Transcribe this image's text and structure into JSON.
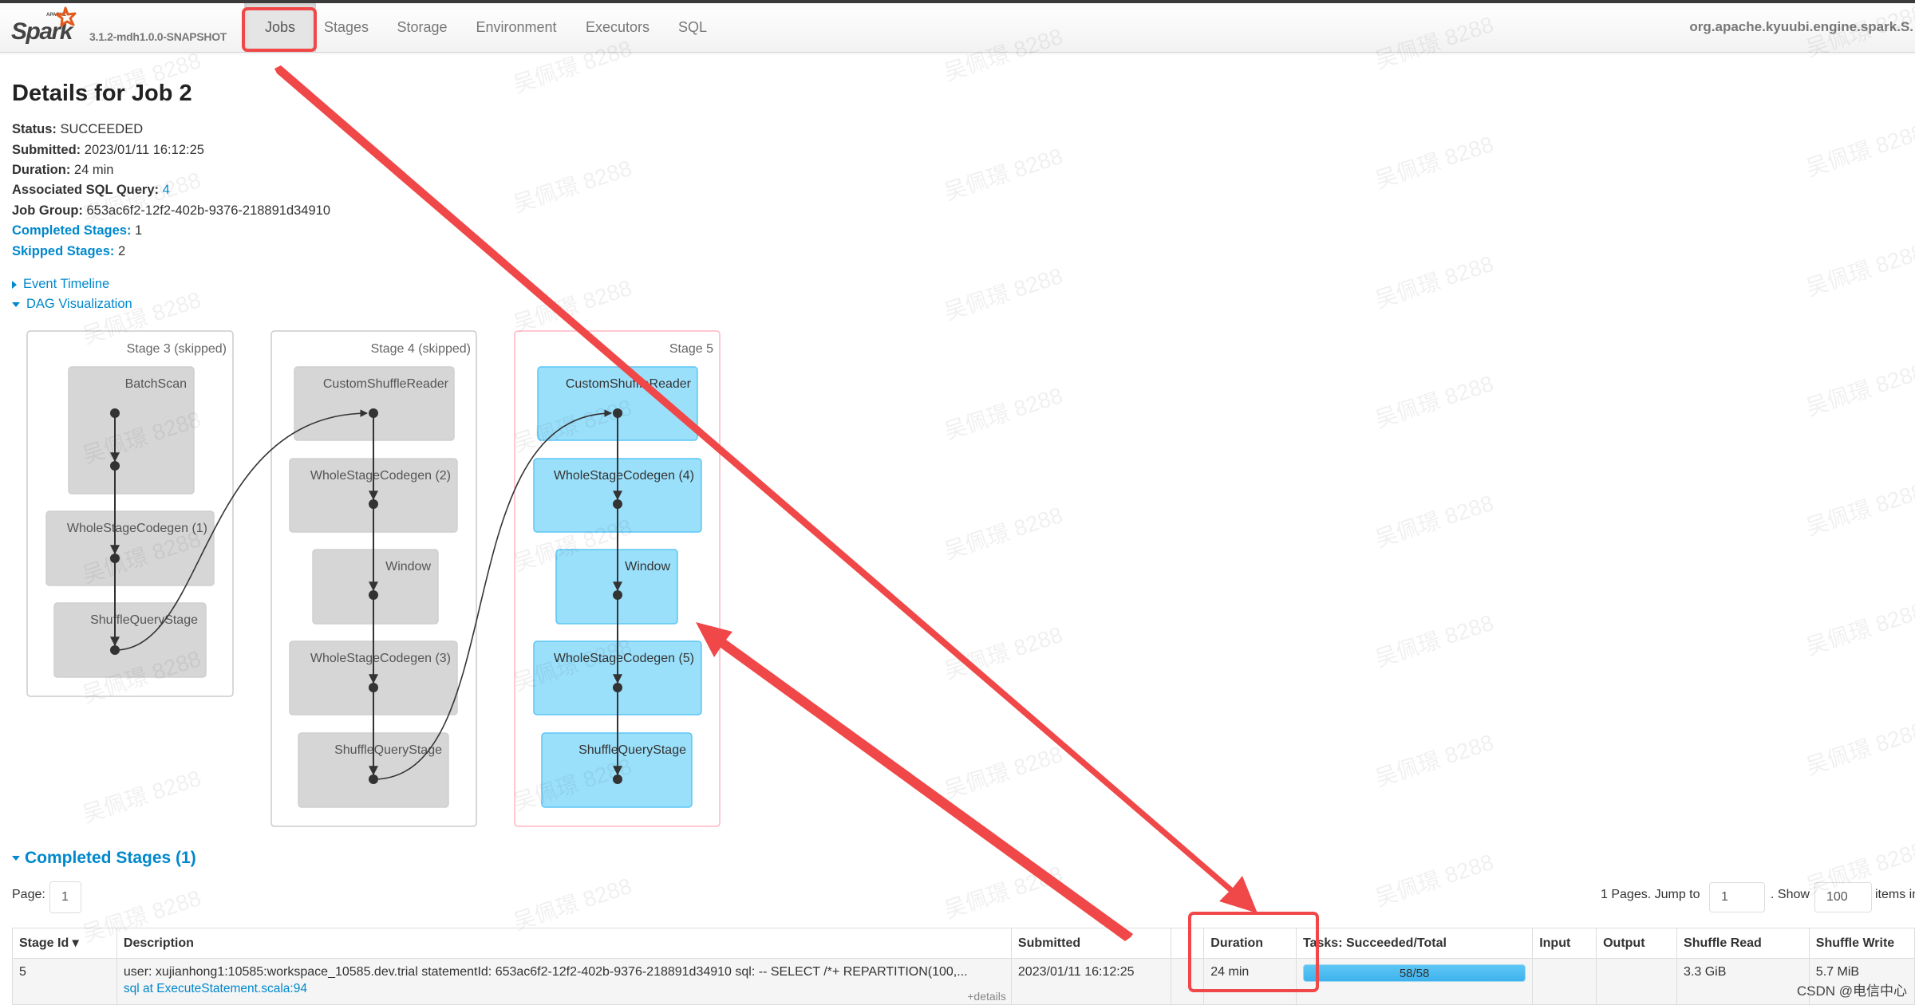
{
  "navbar": {
    "logo_text": "Spark",
    "logo_small": "APACHE",
    "version": "3.1.2-mdh1.0.0-SNAPSHOT",
    "tabs": [
      {
        "label": "Jobs",
        "active": true
      },
      {
        "label": "Stages",
        "active": false
      },
      {
        "label": "Storage",
        "active": false
      },
      {
        "label": "Environment",
        "active": false
      },
      {
        "label": "Executors",
        "active": false
      },
      {
        "label": "SQL",
        "active": false
      }
    ],
    "app_name": "org.apache.kyuubi.engine.spark.S."
  },
  "job": {
    "title": "Details for Job 2",
    "status_label": "Status:",
    "status": "SUCCEEDED",
    "submitted_label": "Submitted:",
    "submitted": "2023/01/11 16:12:25",
    "duration_label": "Duration:",
    "duration": "24 min",
    "sql_query_label": "Associated SQL Query:",
    "sql_query": "4",
    "job_group_label": "Job Group:",
    "job_group": "653ac6f2-12f2-402b-9376-218891d34910",
    "completed_stages_label": "Completed Stages:",
    "completed_stages": "1",
    "skipped_stages_label": "Skipped Stages:",
    "skipped_stages": "2"
  },
  "toggles": {
    "event_timeline": "Event Timeline",
    "dag_visualization": "DAG Visualization"
  },
  "dag": {
    "stages": [
      {
        "label": "Stage 3 (skipped)",
        "state": "skipped",
        "nodes": [
          "BatchScan",
          "WholeStageCodegen (1)",
          "ShuffleQueryStage"
        ]
      },
      {
        "label": "Stage 4 (skipped)",
        "state": "skipped",
        "nodes": [
          "CustomShuffleReader",
          "WholeStageCodegen (2)",
          "Window",
          "WholeStageCodegen (3)",
          "ShuffleQueryStage"
        ]
      },
      {
        "label": "Stage 5",
        "state": "completed",
        "nodes": [
          "CustomShuffleReader",
          "WholeStageCodegen (4)",
          "Window",
          "WholeStageCodegen (5)",
          "ShuffleQueryStage"
        ]
      }
    ],
    "colors": {
      "skipped_fill": "#d6d6d6",
      "active_fill": "#9be0fb",
      "active_stroke": "#5cc6f5",
      "active_cluster": "#ffb6c4"
    }
  },
  "completed_stages": {
    "heading": "Completed Stages (1)",
    "page_label": "Page:",
    "page_value": "1",
    "pages_text": "1 Pages. Jump to",
    "jump_value": "1",
    "show_text": ". Show",
    "show_value": "100",
    "items_text": "items in a page. Go",
    "columns": [
      "Stage Id ▾",
      "Description",
      "Submitted",
      "",
      "Duration",
      "Tasks: Succeeded/Total",
      "Input",
      "Output",
      "Shuffle Read",
      "Shuffle Write"
    ],
    "rows": [
      {
        "stage_id": "5",
        "description": "user: xujianhong1:10585:workspace_10585.dev.trial statementId: 653ac6f2-12f2-402b-9376-218891d34910 sql: -- SELECT /*+ REPARTITION(100,...",
        "description_link": "sql at ExecuteStatement.scala:94",
        "details_link": "+details",
        "submitted": "2023/01/11 16:12:25",
        "blank": "",
        "duration": "24 min",
        "tasks": "58/58",
        "tasks_progress": 1.0,
        "input": "",
        "output": "",
        "shuffle_read": "3.3 GiB",
        "shuffle_write": "5.7 MiB"
      }
    ]
  },
  "watermark": {
    "text": "吴佩璟 8288",
    "credit": "CSDN @电信中心"
  },
  "annotation_color": "#f04848"
}
